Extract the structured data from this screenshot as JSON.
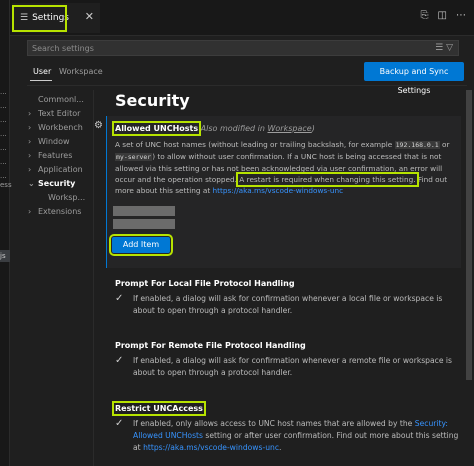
{
  "left_strip": {
    "items": [
      "...",
      "...",
      "...",
      "...",
      "...",
      "...",
      "...",
      "ess"
    ],
    "file_badge": "js"
  },
  "tab": {
    "icon": "settings-lines-icon",
    "label": "Settings",
    "close": "✕"
  },
  "toolbar_icons": [
    "open-json-icon",
    "split-editor-icon",
    "more-actions-icon"
  ],
  "search": {
    "placeholder": "Search settings"
  },
  "scopes": {
    "user": "User",
    "workspace": "Workspace"
  },
  "sync_button": "Backup and Sync Settings",
  "toc": [
    {
      "label": "Commonl...",
      "chev": ""
    },
    {
      "label": "Text Editor",
      "chev": "›"
    },
    {
      "label": "Workbench",
      "chev": "›"
    },
    {
      "label": "Window",
      "chev": "›"
    },
    {
      "label": "Features",
      "chev": "›"
    },
    {
      "label": "Application",
      "chev": "›"
    },
    {
      "label": "Security",
      "chev": "⌄"
    },
    {
      "label": "Worksp...",
      "chev": ""
    },
    {
      "label": "Extensions",
      "chev": "›"
    }
  ],
  "section_title": "Security",
  "allowed_unc": {
    "title": "Allowed UNCHosts",
    "also_prefix": "Also modified in",
    "also_link": "Workspace",
    "desc_1": "A set of UNC host names (without leading or trailing backslash, for example",
    "code_1": "192.168.0.1",
    "desc_or": "or",
    "code_2": "my-server",
    "desc_2": ") to allow without user confirmation. If a UNC host is being accessed that is not allowed via this setting or has not been acknowledged via user confirmation, an error will occur and the operation stopped.",
    "restart": "A restart is required when changing this setting.",
    "desc_3": "Find out more about this setting at",
    "link": "https://aka.ms/vscode-windows-unc",
    "add_item": "Add Item"
  },
  "prompt_local": {
    "title": "Prompt For Local File Protocol Handling",
    "desc": "If enabled, a dialog will ask for confirmation whenever a local file or workspace is about to open through a protocol handler."
  },
  "prompt_remote": {
    "title": "Prompt For Remote File Protocol Handling",
    "desc": "If enabled, a dialog will ask for confirmation whenever a remote file or workspace is about to open through a protocol handler."
  },
  "restrict_unc": {
    "title": "Restrict UNCAccess",
    "desc_1": "If enabled, only allows access to UNC host names that are allowed by the",
    "link_1": "Security: Allowed UNCHosts",
    "desc_2": "setting or after user confirmation. Find out more about this setting at",
    "link_2": "https://aka.ms/vscode-windows-unc",
    "desc_end": "."
  },
  "colors": {
    "highlight": "#b7e300",
    "accent": "#0078d4",
    "link": "#3794ff",
    "background": "#1f1f1f"
  }
}
